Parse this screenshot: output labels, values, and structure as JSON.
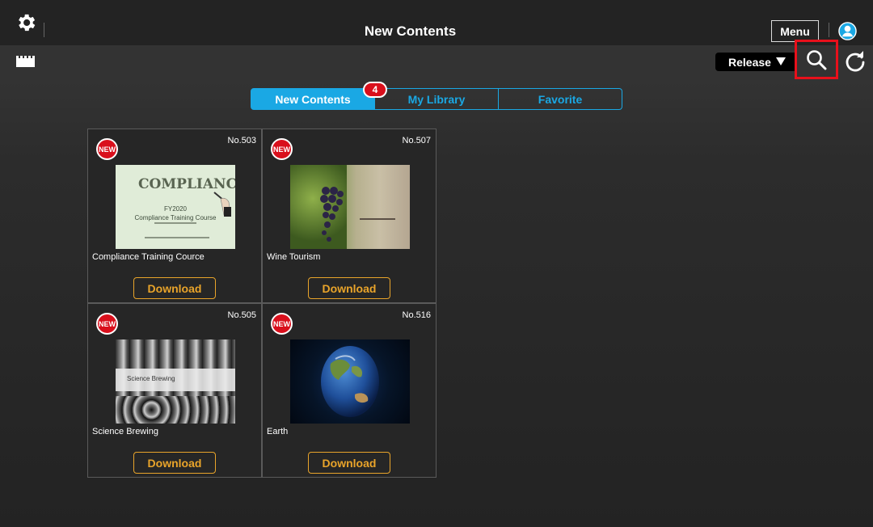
{
  "header": {
    "title": "New Contents",
    "menu_label": "Menu"
  },
  "toolbar": {
    "release_label": "Release"
  },
  "tabs": [
    {
      "label": "New Contents",
      "active": true
    },
    {
      "label": "My Library",
      "active": false
    },
    {
      "label": "Favorite",
      "active": false
    }
  ],
  "new_count": "4",
  "cards": [
    {
      "no": "No.503",
      "title": "Compliance Training Cource",
      "new_label": "NEW",
      "download_label": "Download",
      "thumb_text": {
        "heading": "COMPLIANCE",
        "line1": "FY2020",
        "line2": "Compliance Training Course"
      }
    },
    {
      "no": "No.507",
      "title": "Wine Tourism",
      "new_label": "NEW",
      "download_label": "Download"
    },
    {
      "no": "No.505",
      "title": "Science Brewing",
      "new_label": "NEW",
      "download_label": "Download",
      "thumb_text": {
        "heading": "Science Brewing"
      }
    },
    {
      "no": "No.516",
      "title": "Earth",
      "new_label": "NEW",
      "download_label": "Download"
    }
  ],
  "colors": {
    "accent_blue": "#1aa8e4",
    "download_orange": "#e9a42a",
    "badge_red": "#d90f1c",
    "highlight_red": "#e8101b"
  },
  "icons": [
    "gear-icon",
    "user-icon",
    "film-icon",
    "dropdown-arrow-icon",
    "search-icon",
    "refresh-icon"
  ]
}
